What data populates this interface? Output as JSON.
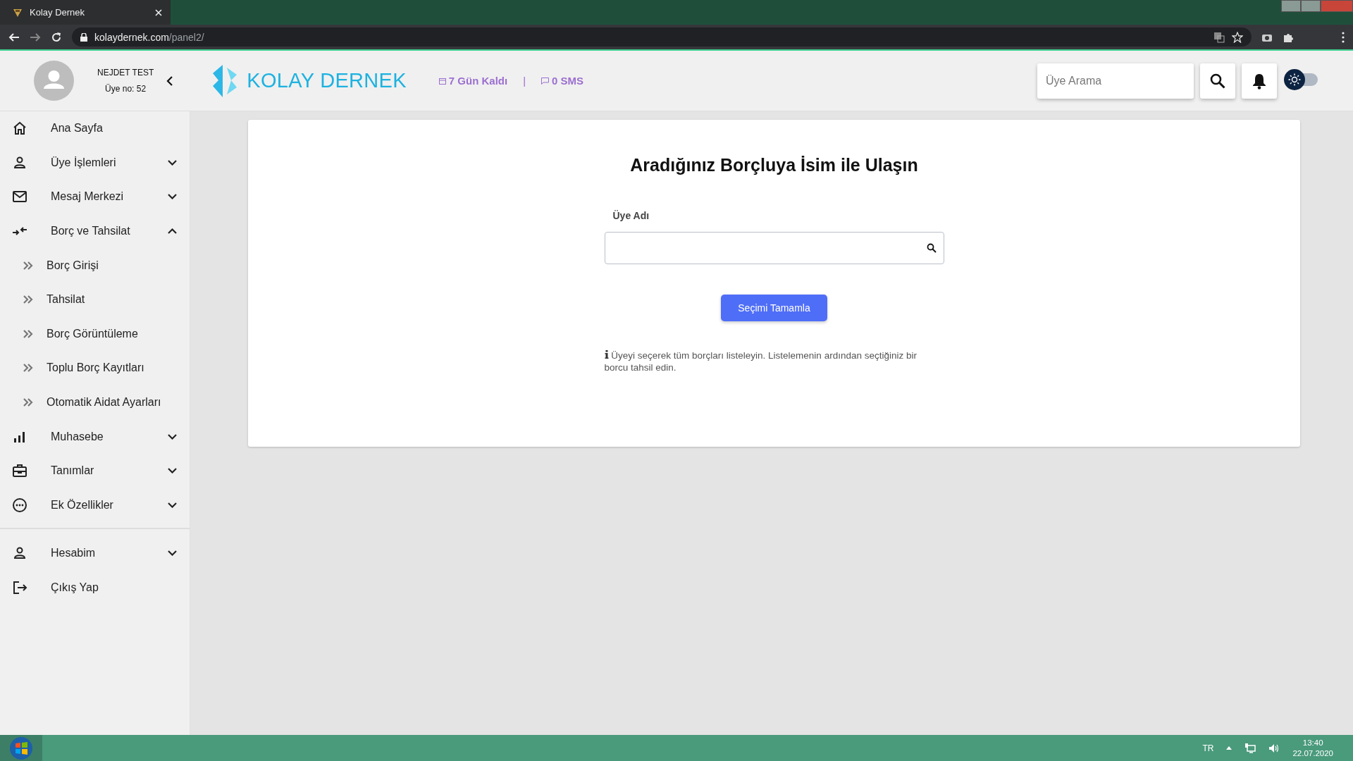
{
  "browser": {
    "tab_title": "Kolay Dernek",
    "url_host": "kolaydernek.com",
    "url_path": "/panel2/"
  },
  "header": {
    "user_name": "NEJDET TEST",
    "member_no": "Üye no: 52",
    "logo": "KOLAY DERNEK",
    "days_left": "7 Gün Kaldı",
    "separator": "|",
    "sms": "0 SMS",
    "search": {
      "placeholder": "Üye Arama"
    },
    "dark_mode": false
  },
  "sidebar": {
    "items": [
      {
        "label": "Ana Sayfa",
        "kind": "link"
      },
      {
        "label": "Üye İşlemleri",
        "kind": "group",
        "expanded": false
      },
      {
        "label": "Mesaj Merkezi",
        "kind": "group",
        "expanded": false
      },
      {
        "label": "Borç ve Tahsilat",
        "kind": "group",
        "expanded": true,
        "children": [
          {
            "label": "Borç Girişi"
          },
          {
            "label": "Tahsilat"
          },
          {
            "label": "Borç Görüntüleme"
          },
          {
            "label": "Toplu Borç Kayıtları"
          },
          {
            "label": "Otomatik Aidat Ayarları"
          }
        ]
      },
      {
        "label": "Muhasebe",
        "kind": "group",
        "expanded": false
      },
      {
        "label": "Tanımlar",
        "kind": "group",
        "expanded": false
      },
      {
        "label": "Ek Özellikler",
        "kind": "group",
        "expanded": false
      }
    ],
    "account_items": [
      {
        "label": "Hesabim",
        "kind": "group",
        "expanded": false
      },
      {
        "label": "Çıkış Yap",
        "kind": "link"
      }
    ]
  },
  "main": {
    "title": "Aradığınız Borçluya İsim ile Ulaşın",
    "field_label": "Üye Adı",
    "button": "Seçimi Tamamla",
    "info": "Üyeyi seçerek tüm borçları listeleyin. Listelemenin ardından seçtiğiniz bir borcu tahsil edin."
  },
  "taskbar": {
    "language": "TR",
    "time": "13:40",
    "date": "22.07.2020"
  }
}
